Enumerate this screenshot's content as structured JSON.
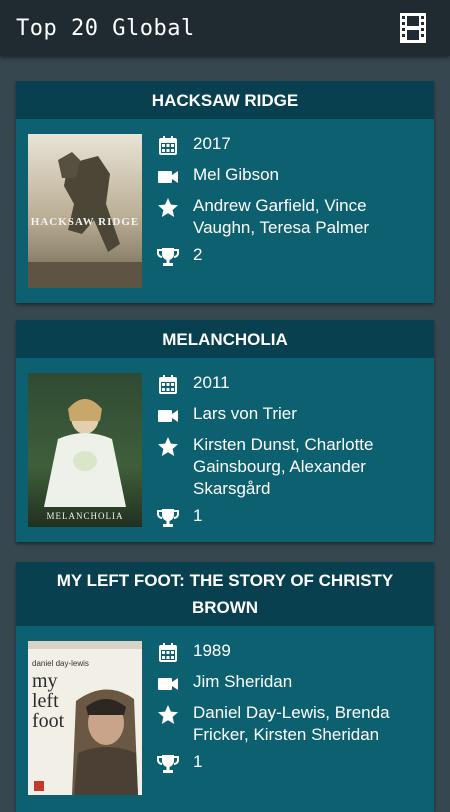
{
  "appbar": {
    "title": "Top 20 Global",
    "icon": "film-strip-icon"
  },
  "icons": {
    "year": "calendar-icon",
    "director": "video-camera-icon",
    "cast": "star-icon",
    "awards": "trophy-icon"
  },
  "colors": {
    "background": "#37474f",
    "appbar": "#1f2b31",
    "card": "#0d6070",
    "card_header": "#08404f",
    "text": "#ffffff"
  },
  "movies": [
    {
      "title": "HACKSAW RIDGE",
      "year": "2017",
      "director": "Mel Gibson",
      "cast": "Andrew Garfield, Vince Vaughn, Teresa Palmer",
      "awards": "2",
      "poster_title": "HACKSAW RIDGE"
    },
    {
      "title": "MELANCHOLIA",
      "year": "2011",
      "director": "Lars von Trier",
      "cast": "Kirsten Dunst, Charlotte Gainsbourg, Alexander Skarsgård",
      "awards": "1",
      "poster_title": "MELANCHOLIA"
    },
    {
      "title": "MY LEFT FOOT: THE STORY OF CHRISTY BROWN",
      "year": "1989",
      "director": "Jim Sheridan",
      "cast": "Daniel Day-Lewis, Brenda Fricker, Kirsten Sheridan",
      "awards": "1",
      "poster_actor": "daniel day-lewis",
      "poster_title": "my left foot"
    }
  ]
}
